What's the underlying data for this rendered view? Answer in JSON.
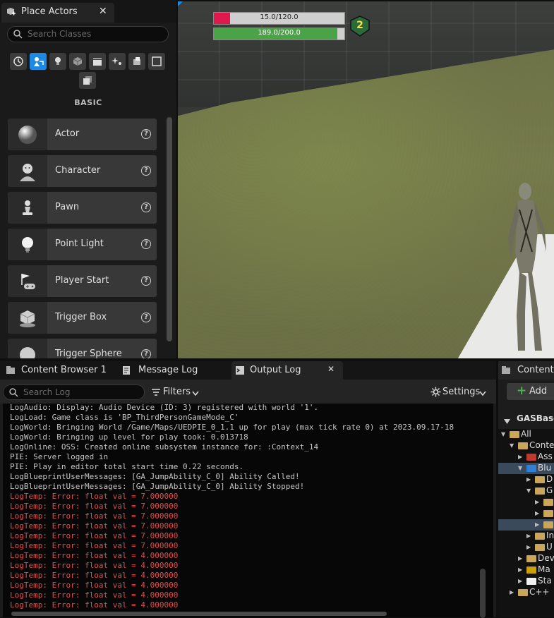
{
  "place_actors": {
    "title": "Place Actors",
    "search_placeholder": "Search Classes",
    "category_label": "BASIC",
    "items": [
      {
        "label": "Actor",
        "icon": "sphere-icon"
      },
      {
        "label": "Character",
        "icon": "character-icon"
      },
      {
        "label": "Pawn",
        "icon": "pawn-icon"
      },
      {
        "label": "Point Light",
        "icon": "lightbulb-icon"
      },
      {
        "label": "Player Start",
        "icon": "player-start-icon"
      },
      {
        "label": "Trigger Box",
        "icon": "trigger-box-icon"
      },
      {
        "label": "Trigger Sphere",
        "icon": "trigger-sphere-icon"
      }
    ]
  },
  "hud": {
    "health_text": "15.0/120.0",
    "health_fraction": 0.125,
    "stamina_text": "189.0/200.0",
    "stamina_fraction": 0.945,
    "level": "2"
  },
  "bottom_tabs": {
    "content_browser": "Content Browser 1",
    "message_log": "Message Log",
    "output_log": "Output Log"
  },
  "output_log": {
    "search_placeholder": "Search Log",
    "filters_label": "Filters",
    "settings_label": "Settings",
    "lines": [
      {
        "text": "LogAudio: Display: Audio Device (ID: 3) registered with world '1'.",
        "error": false
      },
      {
        "text": "LogLoad: Game class is 'BP_ThirdPersonGameMode_C'",
        "error": false
      },
      {
        "text": "LogWorld: Bringing World /Game/Maps/UEDPIE_0_1.1 up for play (max tick rate 0) at 2023.09.17-18",
        "error": false
      },
      {
        "text": "LogWorld: Bringing up level for play took: 0.013718",
        "error": false
      },
      {
        "text": "LogOnline: OSS: Created online subsystem instance for: :Context_14",
        "error": false
      },
      {
        "text": "PIE: Server logged in",
        "error": false
      },
      {
        "text": "PIE: Play in editor total start time 0.22 seconds.",
        "error": false
      },
      {
        "text": "LogBlueprintUserMessages: [GA_JumpAbility_C_0] Ability Called!",
        "error": false
      },
      {
        "text": "LogBlueprintUserMessages: [GA_JumpAbility_C_0] Ability Stopped!",
        "error": false
      },
      {
        "text": "LogTemp: Error: float val = 7.000000",
        "error": true
      },
      {
        "text": "LogTemp: Error: float val = 7.000000",
        "error": true
      },
      {
        "text": "LogTemp: Error: float val = 7.000000",
        "error": true
      },
      {
        "text": "LogTemp: Error: float val = 7.000000",
        "error": true
      },
      {
        "text": "LogTemp: Error: float val = 7.000000",
        "error": true
      },
      {
        "text": "LogTemp: Error: float val = 7.000000",
        "error": true
      },
      {
        "text": "LogTemp: Error: float val = 4.000000",
        "error": true
      },
      {
        "text": "LogTemp: Error: float val = 4.000000",
        "error": true
      },
      {
        "text": "LogTemp: Error: float val = 4.000000",
        "error": true
      },
      {
        "text": "LogTemp: Error: float val = 4.000000",
        "error": true
      },
      {
        "text": "LogTemp: Error: float val = 4.000000",
        "error": true
      },
      {
        "text": "LogTemp: Error: float val = 4.000000",
        "error": true
      }
    ]
  },
  "content_browser_right": {
    "tab_label": "Content B",
    "add_label": "Add",
    "root_label": "GASBase",
    "tree": [
      {
        "label": "All",
        "color": "#c9a65a",
        "open": true,
        "selected": false
      },
      {
        "label": "Conte",
        "color": "#c9a65a",
        "open": true,
        "selected": false
      },
      {
        "label": "Ass",
        "color": "#c0392b",
        "open": false,
        "selected": false
      },
      {
        "label": "Blu",
        "color": "#2f7fd6",
        "open": true,
        "selected": true
      },
      {
        "label": "D",
        "color": "#c9a65a",
        "open": false,
        "selected": false
      },
      {
        "label": "G",
        "color": "#c9a65a",
        "open": true,
        "selected": false
      },
      {
        "label": "",
        "color": "#c9a65a",
        "open": false,
        "selected": false
      },
      {
        "label": "",
        "color": "#c9a65a",
        "open": false,
        "selected": false
      },
      {
        "label": "",
        "color": "#c9a65a",
        "open": false,
        "selected": true
      },
      {
        "label": "In",
        "color": "#c9a65a",
        "open": false,
        "selected": false
      },
      {
        "label": "U",
        "color": "#c9a65a",
        "open": false,
        "selected": false
      },
      {
        "label": "Dev",
        "color": "#c9a65a",
        "open": false,
        "selected": false
      },
      {
        "label": "Ma",
        "color": "#c9a000",
        "open": false,
        "selected": false
      },
      {
        "label": "Sta",
        "color": "#f0f0f0",
        "open": false,
        "selected": false
      },
      {
        "label": "C++",
        "color": "#c9a65a",
        "open": false,
        "selected": false
      }
    ]
  }
}
